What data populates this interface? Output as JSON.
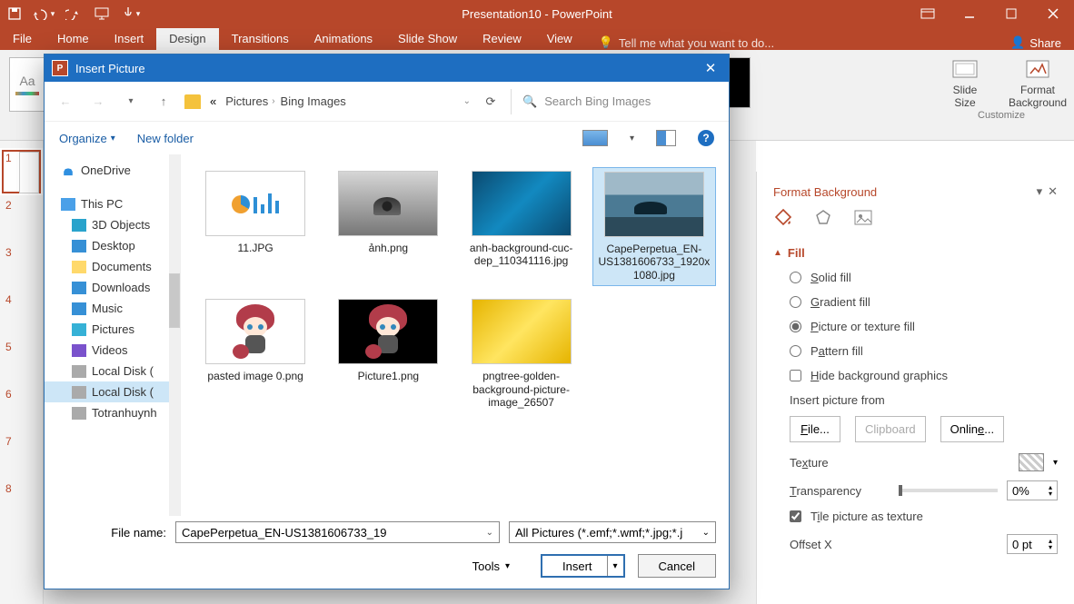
{
  "titlebar": {
    "title": "Presentation10 - PowerPoint"
  },
  "ribbon": {
    "tabs": [
      "File",
      "Home",
      "Insert",
      "Design",
      "Transitions",
      "Animations",
      "Slide Show",
      "Review",
      "View"
    ],
    "active_tab_index": 3,
    "tell_me": "Tell me what you want to do...",
    "share": "Share",
    "customize_group": "Customize",
    "slide_size": "Slide\nSize",
    "format_bg": "Format\nBackground"
  },
  "slides": {
    "count": 8,
    "selected": 1
  },
  "format_background": {
    "title": "Format Background",
    "fill_label": "Fill",
    "solid": "Solid fill",
    "gradient": "Gradient fill",
    "picture": "Picture or texture fill",
    "pattern": "Pattern fill",
    "hide_bg": "Hide background graphics",
    "insert_from": "Insert picture from",
    "file_btn": "File...",
    "clipboard_btn": "Clipboard",
    "online_btn": "Online...",
    "texture": "Texture",
    "transparency": "Transparency",
    "transparency_val": "0%",
    "tile": "Tile picture as texture",
    "offset_x": "Offset X",
    "offset_x_val": "0 pt"
  },
  "dialog": {
    "title": "Insert Picture",
    "breadcrumb_lead": "«",
    "breadcrumb": [
      "Pictures",
      "Bing Images"
    ],
    "search_placeholder": "Search Bing Images",
    "organize": "Organize",
    "new_folder": "New folder",
    "tree": [
      {
        "label": "OneDrive",
        "icon": "cloud",
        "lv": 1
      },
      {
        "label": "This PC",
        "icon": "pc",
        "lv": 1
      },
      {
        "label": "3D Objects",
        "icon": "3d",
        "lv": 2
      },
      {
        "label": "Desktop",
        "icon": "desk",
        "lv": 2
      },
      {
        "label": "Documents",
        "icon": "doc",
        "lv": 2
      },
      {
        "label": "Downloads",
        "icon": "dl",
        "lv": 2
      },
      {
        "label": "Music",
        "icon": "music",
        "lv": 2
      },
      {
        "label": "Pictures",
        "icon": "pic",
        "lv": 2
      },
      {
        "label": "Videos",
        "icon": "vid",
        "lv": 2
      },
      {
        "label": "Local Disk (",
        "icon": "disk",
        "lv": 2
      },
      {
        "label": "Local Disk (",
        "icon": "disk",
        "lv": 2,
        "sel": true
      },
      {
        "label": "Totranhuynh",
        "icon": "disk",
        "lv": 2
      }
    ],
    "files": [
      {
        "name": "11.JPG",
        "thumb": "doc"
      },
      {
        "name": "ảnh.png",
        "thumb": "anh"
      },
      {
        "name": "anh-background-cuc-dep_110341116.jpg",
        "thumb": "bg"
      },
      {
        "name": "CapePerpetua_EN-US1381606733_1920x1080.jpg",
        "thumb": "cape",
        "sel": true
      },
      {
        "name": "pasted image 0.png",
        "thumb": "paste"
      },
      {
        "name": "Picture1.png",
        "thumb": "pic1"
      },
      {
        "name": "pngtree-golden-background-picture-image_26507",
        "thumb": "gold"
      }
    ],
    "file_name_label": "File name:",
    "file_name_value": "CapePerpetua_EN-US1381606733_19",
    "filter": "All Pictures (*.emf;*.wmf;*.jpg;*.j",
    "tools": "Tools",
    "insert_btn": "Insert",
    "cancel_btn": "Cancel"
  }
}
